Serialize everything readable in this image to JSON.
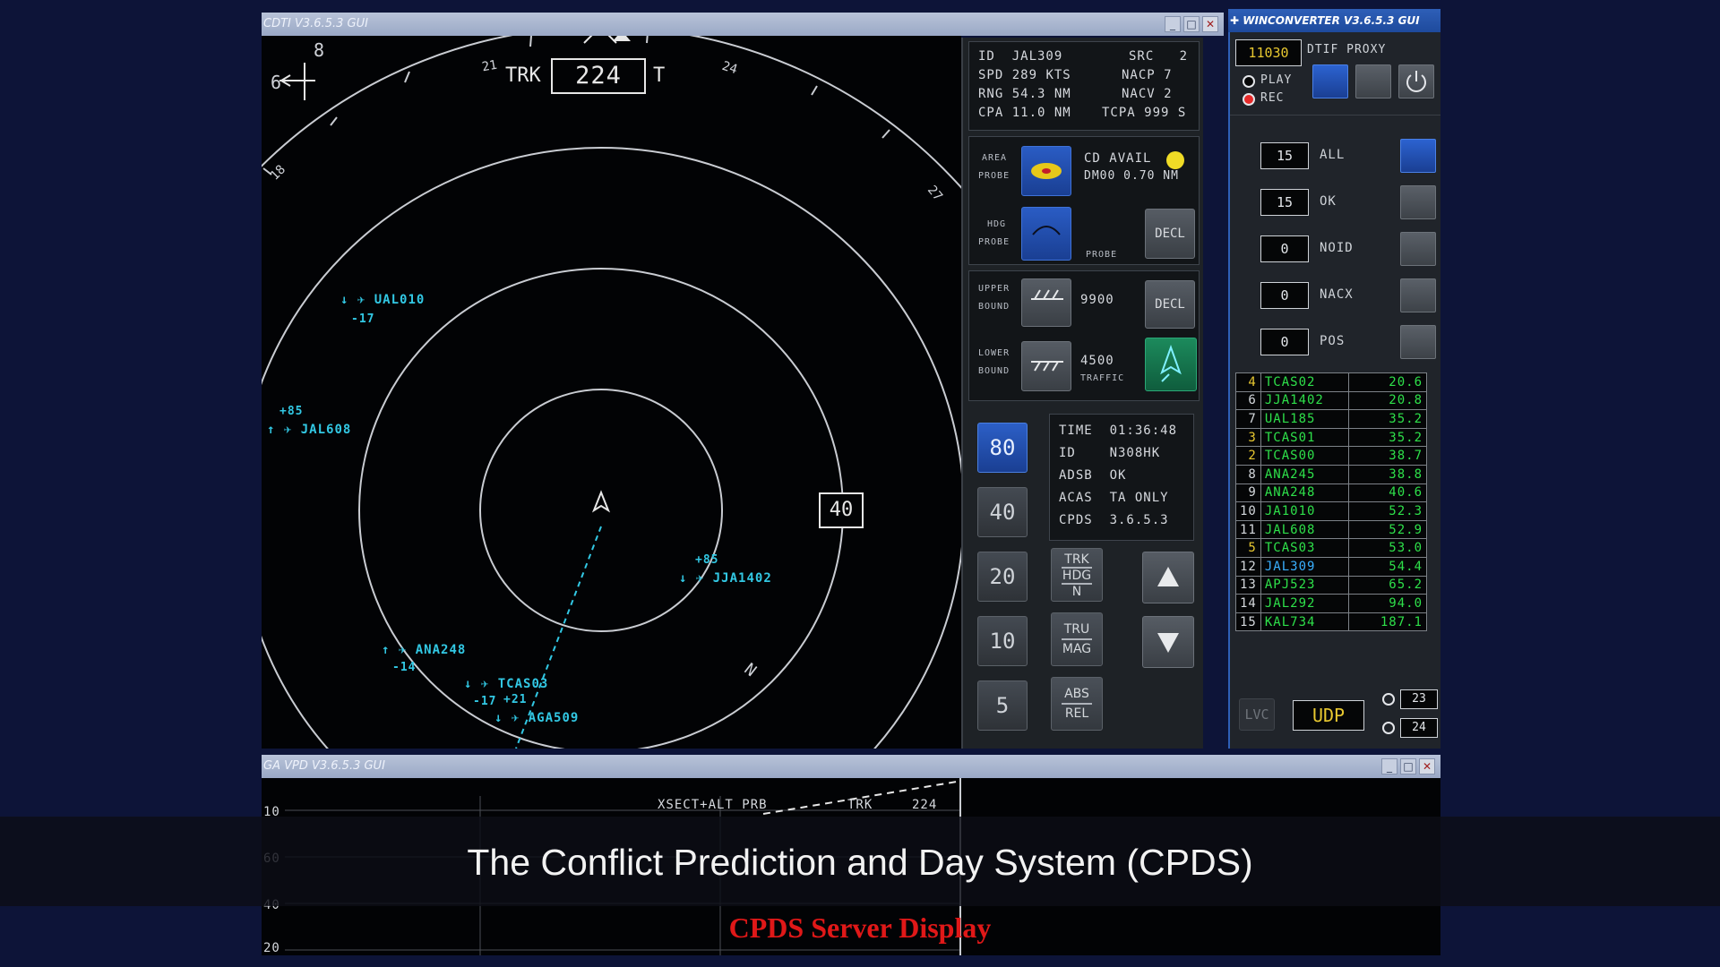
{
  "cdti": {
    "title": "CDTI V3.6.5.3 GUI",
    "track_label": "TRK",
    "track_value": "224",
    "track_suffix": "T",
    "tick_labels": {
      "t21": "21",
      "t24": "24",
      "t18": "18",
      "t27": "27"
    },
    "north_label": "N",
    "range_label": "40",
    "corner_b": "8",
    "corner_6": "6",
    "targets": [
      {
        "callsign": "UAL010",
        "alt": "-17",
        "arrow": "↓"
      },
      {
        "callsign": "JAL608",
        "alt": "+85",
        "arrow": "↑"
      },
      {
        "callsign": "JJA1402",
        "alt": "+85",
        "arrow": "↓"
      },
      {
        "callsign": "ANA248",
        "alt": "-14",
        "arrow": "↑"
      },
      {
        "callsign": "TCAS03",
        "alt": "-17",
        "arrow": "↓"
      },
      {
        "callsign": "AGA509",
        "alt": "+21",
        "arrow": "↓"
      }
    ]
  },
  "panel": {
    "info": {
      "id_label": "ID",
      "id_value": "JAL309",
      "src_label": "SRC",
      "src_value": "2",
      "spd_label": "SPD",
      "spd_value": "289 KTS",
      "nacp_label": "NACP",
      "nacp_value": "7",
      "rng_label": "RNG",
      "rng_value": "54.3 NM",
      "nacv_label": "NACV",
      "nacv_value": "2",
      "cpa_label": "CPA",
      "cpa_value": "11.0 NM",
      "tcpa_label": "TCPA",
      "tcpa_value": "999 S"
    },
    "area_probe": {
      "label1": "AREA",
      "label2": "PROBE",
      "status1": "CD AVAIL",
      "status2": "DM00 0.70 NM"
    },
    "hdg_probe": {
      "label1": "HDG",
      "label2": "PROBE",
      "sub": "PROBE",
      "decl": "DECL"
    },
    "upper_bound": {
      "label1": "UPPER",
      "label2": "BOUND",
      "value": "9900",
      "decl": "DECL"
    },
    "lower_bound": {
      "label1": "LOWER",
      "label2": "BOUND",
      "value": "4500",
      "traffic": "TRAFFIC"
    },
    "ranges": [
      "80",
      "40",
      "20",
      "10",
      "5"
    ],
    "status": {
      "time_label": "TIME",
      "time_value": "01:36:48",
      "id_label": "ID",
      "id_value": "N308HK",
      "adsb_label": "ADSB",
      "adsb_value": "OK",
      "acas_label": "ACAS",
      "acas_value": "TA ONLY",
      "cpds_label": "CPDS",
      "cpds_value": "3.6.5.3"
    },
    "toggles": {
      "trk": [
        "TRK",
        "HDG",
        "N"
      ],
      "tru": [
        "TRU",
        "MAG"
      ],
      "abs": [
        "ABS",
        "REL"
      ]
    }
  },
  "conv": {
    "title": "WINCONVERTER V3.6.5.3 GUI",
    "port": "11030",
    "proxy_label": "DTIF PROXY",
    "play_label": "PLAY",
    "rec_label": "REC",
    "counters": [
      {
        "value": "15",
        "label": "ALL"
      },
      {
        "value": "15",
        "label": "OK"
      },
      {
        "value": "0",
        "label": "NOID"
      },
      {
        "value": "0",
        "label": "NACX"
      },
      {
        "value": "0",
        "label": "POS"
      }
    ],
    "traffic": [
      {
        "n": "4",
        "id": "TCAS02",
        "v": "20.6"
      },
      {
        "n": "6",
        "id": "JJA1402",
        "v": "20.8"
      },
      {
        "n": "7",
        "id": "UAL185",
        "v": "35.2"
      },
      {
        "n": "3",
        "id": "TCAS01",
        "v": "35.2"
      },
      {
        "n": "2",
        "id": "TCAS00",
        "v": "38.7"
      },
      {
        "n": "8",
        "id": "ANA245",
        "v": "38.8"
      },
      {
        "n": "9",
        "id": "ANA248",
        "v": "40.6"
      },
      {
        "n": "10",
        "id": "JA1010",
        "v": "52.3"
      },
      {
        "n": "11",
        "id": "JAL608",
        "v": "52.9"
      },
      {
        "n": "5",
        "id": "TCAS03",
        "v": "53.0"
      },
      {
        "n": "12",
        "id": "JAL309",
        "v": "54.4"
      },
      {
        "n": "13",
        "id": "APJ523",
        "v": "65.2"
      },
      {
        "n": "14",
        "id": "JAL292",
        "v": "94.0"
      },
      {
        "n": "15",
        "id": "KAL734",
        "v": "187.1"
      }
    ],
    "lvc_label": "LVC",
    "udp_label": "UDP",
    "radio_23": "23",
    "radio_24": "24"
  },
  "vpd": {
    "title": "GA VPD V3.6.5.3 GUI",
    "header": "XSECT+ALT PRB",
    "trk_label": "TRK",
    "trk_value": "224",
    "y_labels": [
      "10",
      "60",
      "40",
      "20"
    ]
  },
  "caption": "The Conflict Prediction and Day System (CPDS)",
  "subcaption": "CPDS Server Display"
}
